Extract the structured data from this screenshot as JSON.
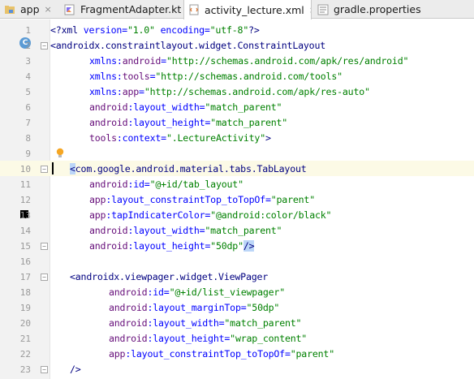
{
  "tabs": [
    {
      "label": "app",
      "icon": "module-folder-icon",
      "active": false
    },
    {
      "label": "FragmentAdapter.kt",
      "icon": "kotlin-file-icon",
      "active": false
    },
    {
      "label": "activity_lecture.xml",
      "icon": "xml-file-icon",
      "active": true
    },
    {
      "label": "gradle.properties",
      "icon": "gradle-file-icon",
      "active": false
    }
  ],
  "close_glyph": "×",
  "gutter_markers": {
    "class_badge": "C",
    "color_swatch": "#000000"
  },
  "code": {
    "l1": {
      "num": "1",
      "a": "<?",
      "b": "xml ",
      "c": "version=",
      "d": "\"1.0\"",
      "e": " encoding=",
      "f": "\"utf-8\"",
      "g": "?>"
    },
    "l2": {
      "num": "2",
      "a": "<androidx.constraintlayout.widget.ConstraintLayout"
    },
    "l3": {
      "num": "3",
      "a": "xmlns:",
      "b": "android",
      "c": "=",
      "d": "\"http://schemas.android.com/apk/res/android\""
    },
    "l4": {
      "num": "4",
      "a": "xmlns:",
      "b": "tools",
      "c": "=",
      "d": "\"http://schemas.android.com/tools\""
    },
    "l5": {
      "num": "5",
      "a": "xmlns:",
      "b": "app",
      "c": "=",
      "d": "\"http://schemas.android.com/apk/res-auto\""
    },
    "l6": {
      "num": "6",
      "a": "android",
      "b": ":layout_width=",
      "c": "\"match_parent\""
    },
    "l7": {
      "num": "7",
      "a": "android",
      "b": ":layout_height=",
      "c": "\"match_parent\""
    },
    "l8": {
      "num": "8",
      "a": "tools",
      "b": ":context=",
      "c": "\".LectureActivity\"",
      "d": ">"
    },
    "l9": {
      "num": "9"
    },
    "l10": {
      "num": "10",
      "a": "<",
      "b": "com.google.android.material.tabs.TabLayout"
    },
    "l11": {
      "num": "11",
      "a": "android",
      "b": ":id=",
      "c": "\"@+id/tab_layout\""
    },
    "l12": {
      "num": "12",
      "a": "app",
      "b": ":layout_constraintTop_toTopOf=",
      "c": "\"parent\""
    },
    "l13": {
      "num": "13",
      "a": "app",
      "b": ":tapIndicaterColor=",
      "c": "\"@android:color/black\""
    },
    "l14": {
      "num": "14",
      "a": "android",
      "b": ":layout_width=",
      "c": "\"match_parent\""
    },
    "l15": {
      "num": "15",
      "a": "android",
      "b": ":layout_height=",
      "c": "\"50dp\"",
      "d": "/>"
    },
    "l16": {
      "num": "16"
    },
    "l17": {
      "num": "17",
      "a": "<androidx.viewpager.widget.ViewPager"
    },
    "l18": {
      "num": "18",
      "a": "android",
      "b": ":id=",
      "c": "\"@+id/list_viewpager\""
    },
    "l19": {
      "num": "19",
      "a": "android",
      "b": ":layout_marginTop=",
      "c": "\"50dp\""
    },
    "l20": {
      "num": "20",
      "a": "android",
      "b": ":layout_width=",
      "c": "\"match_parent\""
    },
    "l21": {
      "num": "21",
      "a": "android",
      "b": ":layout_height=",
      "c": "\"wrap_content\""
    },
    "l22": {
      "num": "22",
      "a": "app",
      "b": ":layout_constraintTop_toTopOf=",
      "c": "\"parent\""
    },
    "l23": {
      "num": "23",
      "a": "/>"
    }
  },
  "colors": {
    "tag": "#000080",
    "attribute": "#0000ff",
    "namespace": "#660e7a",
    "value": "#008000",
    "current_line": "#fcfae6"
  }
}
